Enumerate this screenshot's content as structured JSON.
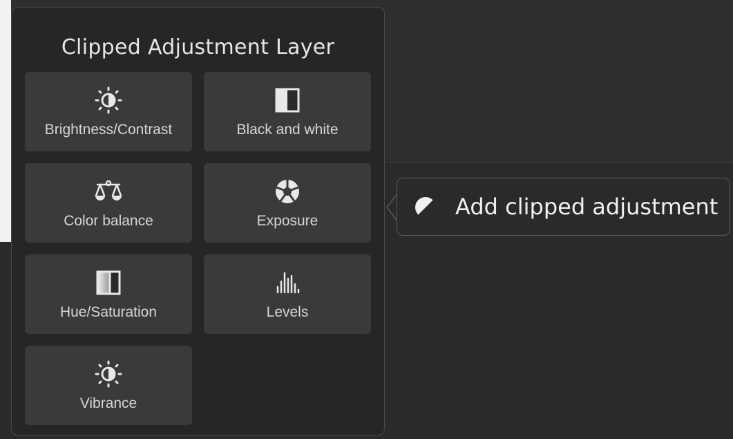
{
  "panel": {
    "title": "Clipped Adjustment Layer",
    "items": [
      {
        "label": "Brightness/Contrast",
        "icon": "brightness-icon"
      },
      {
        "label": "Black and white",
        "icon": "black-white-icon"
      },
      {
        "label": "Color balance",
        "icon": "scale-icon"
      },
      {
        "label": "Exposure",
        "icon": "aperture-icon"
      },
      {
        "label": "Hue/Saturation",
        "icon": "hue-saturation-icon"
      },
      {
        "label": "Levels",
        "icon": "levels-icon"
      },
      {
        "label": "Vibrance",
        "icon": "vibrance-icon"
      }
    ]
  },
  "tooltip": {
    "text": "Add clipped adjustment",
    "icon": "clip-adjust-icon"
  },
  "colors": {
    "panel_bg": "#262626",
    "tile_bg": "#3a3a3a",
    "text": "#d6d6d6"
  }
}
